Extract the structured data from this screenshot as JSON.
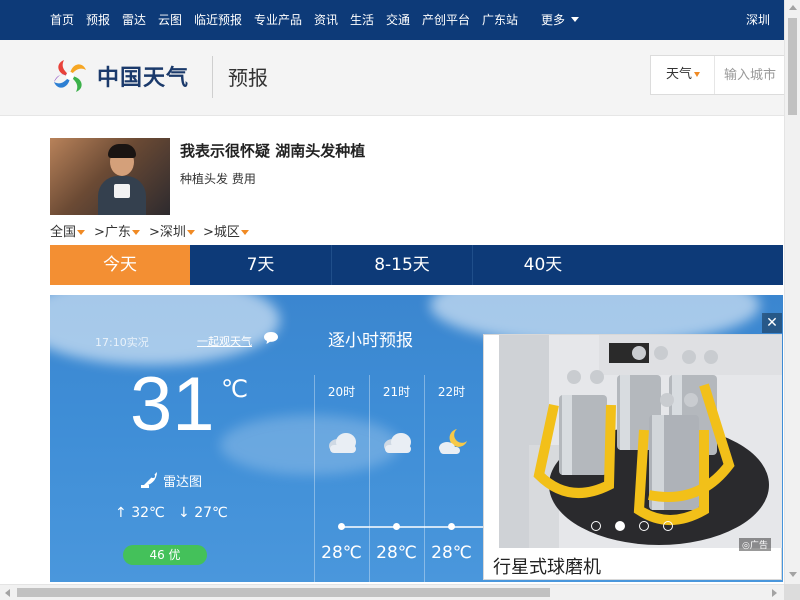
{
  "nav": {
    "items": [
      "首页",
      "预报",
      "雷达",
      "云图",
      "临近预报",
      "专业产品",
      "资讯",
      "生活",
      "交通",
      "产创平台",
      "广东站"
    ],
    "more": "更多",
    "city": "深圳"
  },
  "header": {
    "logo_text": "中国天气",
    "section": "预报",
    "search": {
      "type": "天气",
      "placeholder": "输入城市"
    }
  },
  "news": {
    "title": "我表示很怀疑 湖南头发种植",
    "subtitle": "种植头发 费用"
  },
  "breadcrumb": [
    "全国",
    ">广东",
    ">深圳",
    ">城区"
  ],
  "tabs": [
    {
      "label": "今天",
      "active": true
    },
    {
      "label": "7天",
      "active": false
    },
    {
      "label": "8-15天",
      "active": false
    },
    {
      "label": "40天",
      "active": false
    }
  ],
  "current": {
    "obs_time": "17:10实况",
    "watch_link": "一起观天气",
    "temp": "31",
    "unit": "℃",
    "radar_label": "雷达图",
    "high": "32℃",
    "low": "27℃",
    "aqi": "46 优"
  },
  "hourly": {
    "title": "逐小时预报",
    "hours": [
      {
        "time": "20时",
        "icon": "cloudy-night-icon",
        "temp": "28℃"
      },
      {
        "time": "21时",
        "icon": "cloudy-night-icon",
        "temp": "28℃"
      },
      {
        "time": "22时",
        "icon": "partly-cloudy-night-icon",
        "temp": "28℃"
      }
    ]
  },
  "ad": {
    "caption": "行星式球磨机",
    "badge": "◎广告",
    "close": "✕",
    "slides": 4,
    "active_slide": 1
  },
  "colors": {
    "nav_bg": "#0d3a78",
    "accent_orange": "#f38f33",
    "sky_blue": "#3e8dd6",
    "aqi_green": "#44c15a"
  }
}
